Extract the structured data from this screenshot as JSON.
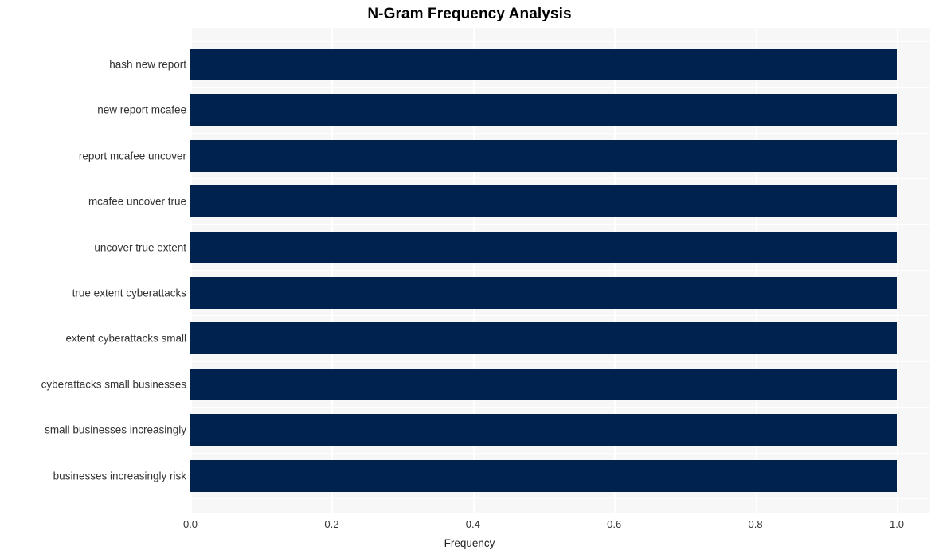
{
  "chart_data": {
    "type": "bar",
    "orientation": "horizontal",
    "title": "N-Gram Frequency Analysis",
    "xlabel": "Frequency",
    "ylabel": "",
    "xlim": [
      0.0,
      1.0
    ],
    "xticks": [
      "0.0",
      "0.2",
      "0.4",
      "0.6",
      "0.8",
      "1.0"
    ],
    "xtick_values": [
      0.0,
      0.2,
      0.4,
      0.6,
      0.8,
      1.0
    ],
    "grid": true,
    "legend": false,
    "categories": [
      "hash new report",
      "new report mcafee",
      "report mcafee uncover",
      "mcafee uncover true",
      "uncover true extent",
      "true extent cyberattacks",
      "extent cyberattacks small",
      "cyberattacks small businesses",
      "small businesses increasingly",
      "businesses increasingly risk"
    ],
    "values": [
      1.0,
      1.0,
      1.0,
      1.0,
      1.0,
      1.0,
      1.0,
      1.0,
      1.0,
      1.0
    ],
    "colors": {
      "bar": "#00224f",
      "plot_background": "#f7f7f7",
      "figure_background": "#ffffff",
      "gridline": "#ffffff",
      "tick_label": "#333333",
      "title": "#000000"
    }
  }
}
